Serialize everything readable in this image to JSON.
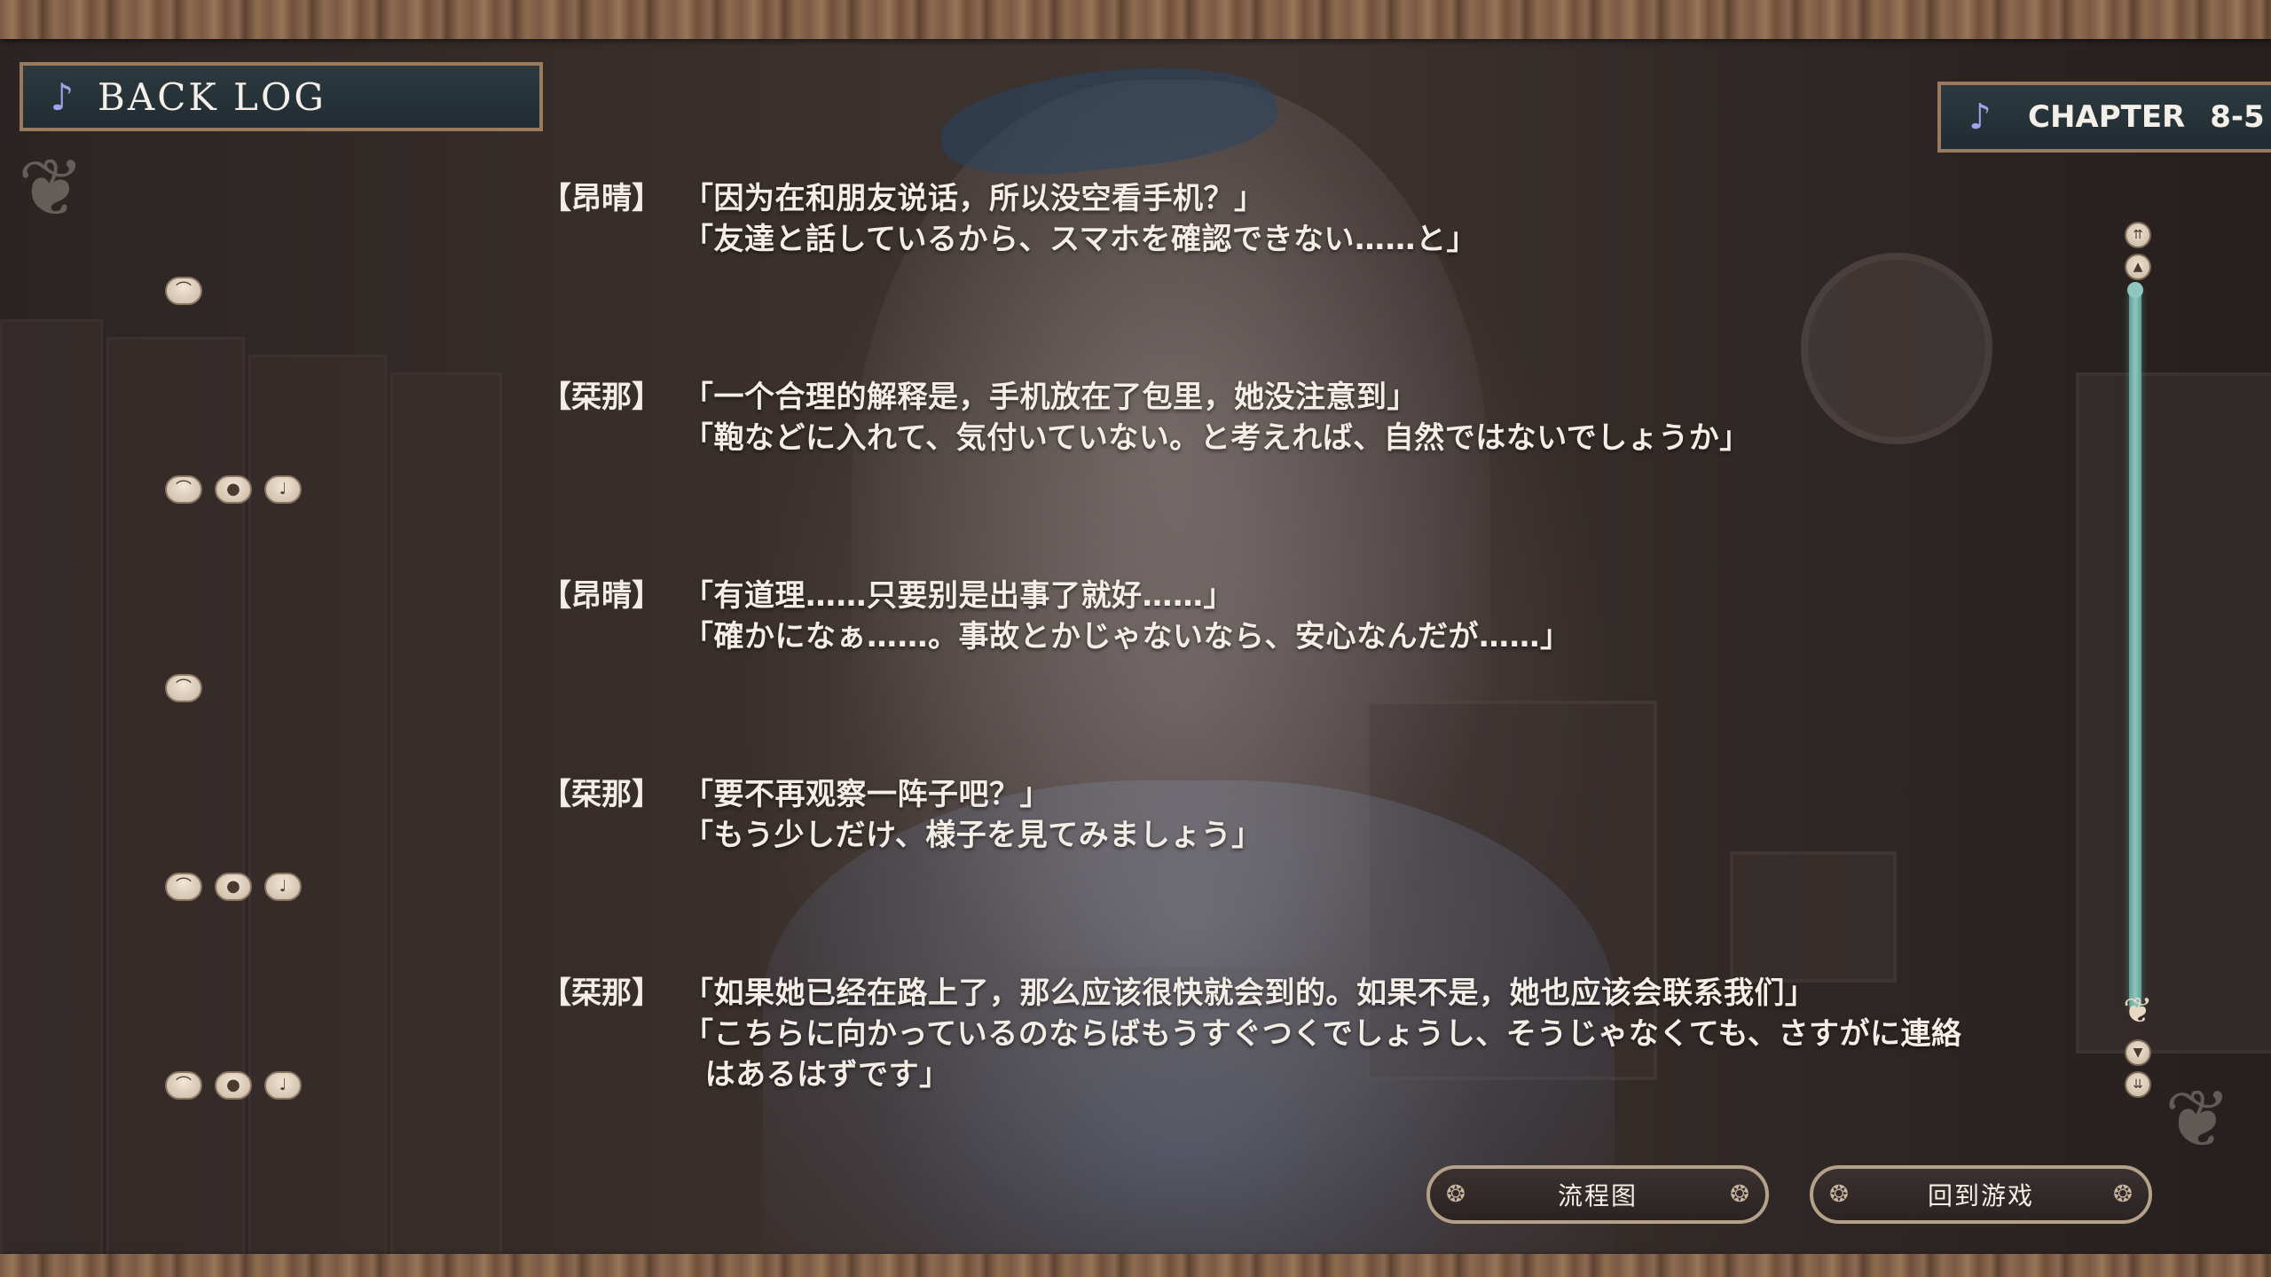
{
  "header": {
    "title": "BACK LOG",
    "chapter_label": "CHAPTER",
    "chapter_number": "8-5"
  },
  "entries": [
    {
      "speaker": "【昂晴】",
      "line_1": "「因为在和朋友说话，所以没空看手机？」",
      "line_2": "「友達と話しているから、スマホを確認できない……と」",
      "line_3": "",
      "actions": [
        "replay-icon"
      ]
    },
    {
      "speaker": "【栞那】",
      "line_1": "「一个合理的解释是，手机放在了包里，她没注意到」",
      "line_2": "「鞄などに入れて、気付いていない。と考えれば、自然ではないでしょうか」",
      "line_3": "",
      "actions": [
        "replay-icon",
        "voice-icon",
        "mic-icon"
      ]
    },
    {
      "speaker": "【昂晴】",
      "line_1": "「有道理……只要别是出事了就好……」",
      "line_2": "「確かになぁ……。事故とかじゃないなら、安心なんだが……」",
      "line_3": "",
      "actions": [
        "replay-icon"
      ]
    },
    {
      "speaker": "【栞那】",
      "line_1": "「要不再观察一阵子吧？」",
      "line_2": "「もう少しだけ、様子を見てみましょう」",
      "line_3": "",
      "actions": [
        "replay-icon",
        "voice-icon",
        "mic-icon"
      ]
    },
    {
      "speaker": "【栞那】",
      "line_1": "「如果她已经在路上了，那么应该很快就会到的。如果不是，她也应该会联系我们」",
      "line_2": "「こちらに向かっているのならばもうすぐつくでしょうし、そうじゃなくても、さすがに連絡",
      "line_3": "  はあるはずです」",
      "actions": [
        "replay-icon",
        "voice-icon",
        "mic-icon"
      ]
    }
  ],
  "scrollbar": {
    "position": 1.0
  },
  "buttons": {
    "flowchart": "流程图",
    "return_to_game": "回到游戏"
  }
}
